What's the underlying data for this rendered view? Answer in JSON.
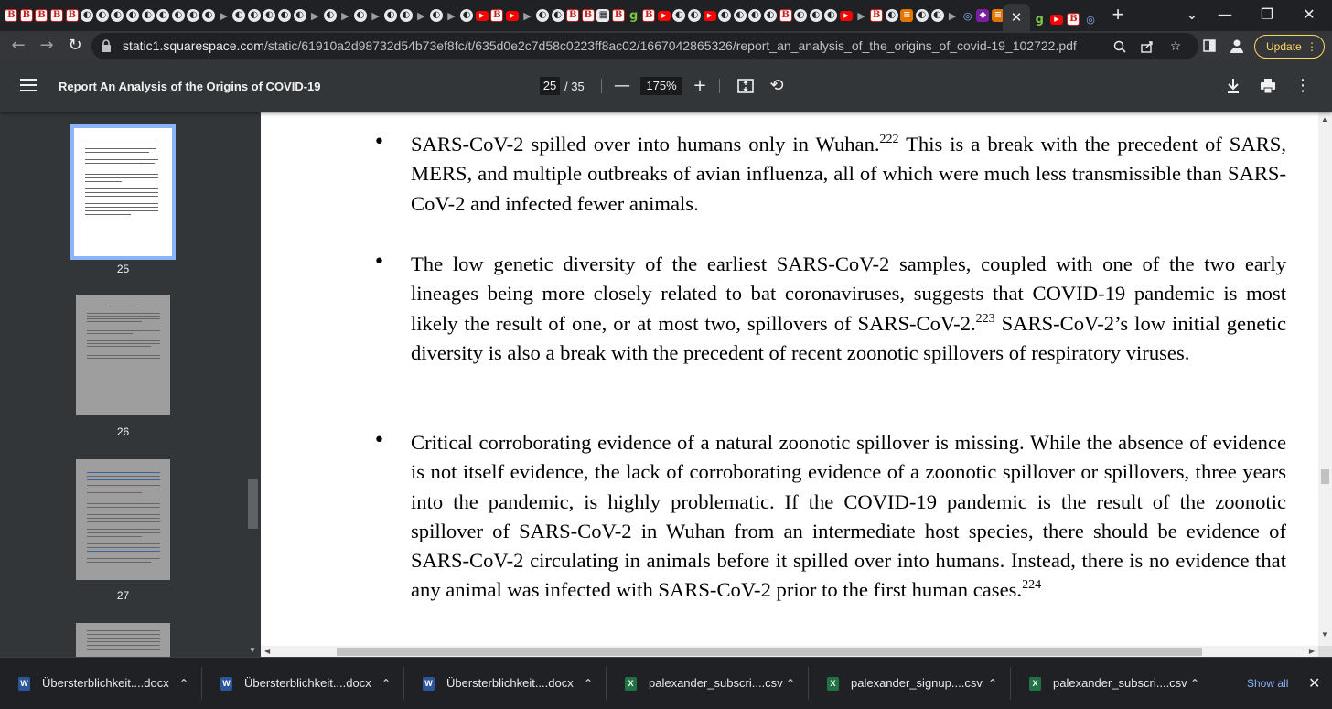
{
  "browser": {
    "tab_favicons": [
      "B",
      "B",
      "B",
      "B",
      "B",
      "C",
      "C",
      "C",
      "C",
      "C",
      "C",
      "C",
      "C",
      "C",
      "D",
      "C",
      "C",
      "C",
      "C",
      "C",
      "D",
      "C",
      "D",
      "C",
      "D",
      "C",
      "C",
      "D",
      "C",
      "D",
      "C",
      "Y",
      "B",
      "Y",
      "D",
      "C",
      "C",
      "B",
      "B",
      "W",
      "B",
      "G",
      "B",
      "Y",
      "C",
      "C",
      "Y",
      "C",
      "C",
      "C",
      "C",
      "B",
      "C",
      "C",
      "C",
      "Y",
      "D",
      "B",
      "C",
      "S",
      "C",
      "C",
      "D",
      "K",
      "P",
      "S",
      "C"
    ],
    "active_tab_close": "✕",
    "after_active_favicons": [
      "G",
      "Y",
      "B",
      "K"
    ],
    "new_tab": "+",
    "window_controls": {
      "dropdown": "⌄",
      "minimize": "—",
      "restore": "❐",
      "close": "✕"
    }
  },
  "toolbar": {
    "back": "←",
    "forward": "→",
    "reload": "↻",
    "url_host": "static1.squarespace.com",
    "url_path": "/static/61910a2d98732d54b73ef8fc/t/635d0e2c7d58c0223ff8ac02/1667042865326/report_an_analysis_of_the_origins_of_covid-19_102722.pdf",
    "update_label": "Update"
  },
  "pdf_toolbar": {
    "title": "Report An Analysis of the Origins of COVID-19",
    "current_page": "25",
    "total_pages": "/ 35",
    "zoom": "175%"
  },
  "thumbnails": [
    {
      "label": "25",
      "selected": true
    },
    {
      "label": "26",
      "selected": false
    },
    {
      "label": "27",
      "selected": false
    }
  ],
  "content": {
    "bullets": [
      {
        "text_a": "SARS-CoV-2 spilled over into humans only in Wuhan.",
        "ref_a": "222",
        "text_b": " This is a break with the precedent of SARS, MERS, and multiple outbreaks of avian influenza, all of which were much less transmissible than SARS-CoV-2 and infected fewer animals."
      },
      {
        "text_a": "The low genetic diversity of the earliest SARS-CoV-2 samples, coupled with one of the two early lineages being more closely related to bat coronaviruses, suggests that COVID-19 pandemic is most likely the result of one, or at most two, spillovers of SARS-CoV-2.",
        "ref_a": "223",
        "text_b": " SARS-CoV-2’s low initial genetic diversity is also a break with the precedent of recent zoonotic spillovers of respiratory viruses."
      },
      {
        "text_a": "Critical corroborating evidence of a natural zoonotic spillover is missing. While the absence of evidence is not itself evidence, the lack of corroborating evidence of a zoonotic spillover or spillovers, three years into the pandemic, is highly problematic.  If the COVID-19 pandemic is the result of the zoonotic spillover of SARS-CoV-2 in Wuhan from an intermediate host species, there should be evidence of SARS-CoV-2 circulating in animals before it spilled over into humans. Instead, there is no evidence that any animal was infected with SARS-CoV-2 prior to the first human cases.",
        "ref_a": "224",
        "text_b": ""
      }
    ]
  },
  "downloads": {
    "items": [
      {
        "name": "Übersterblichkeit....docx",
        "type": "docx",
        "icon": "W"
      },
      {
        "name": "Übersterblichkeit....docx",
        "type": "docx",
        "icon": "W"
      },
      {
        "name": "Übersterblichkeit....docx",
        "type": "docx",
        "icon": "W"
      },
      {
        "name": "palexander_subscri....csv",
        "type": "csv",
        "icon": "X"
      },
      {
        "name": "palexander_signup....csv",
        "type": "csv",
        "icon": "X"
      },
      {
        "name": "palexander_subscri....csv",
        "type": "csv",
        "icon": "X"
      }
    ],
    "show_all": "Show all",
    "close": "✕"
  }
}
